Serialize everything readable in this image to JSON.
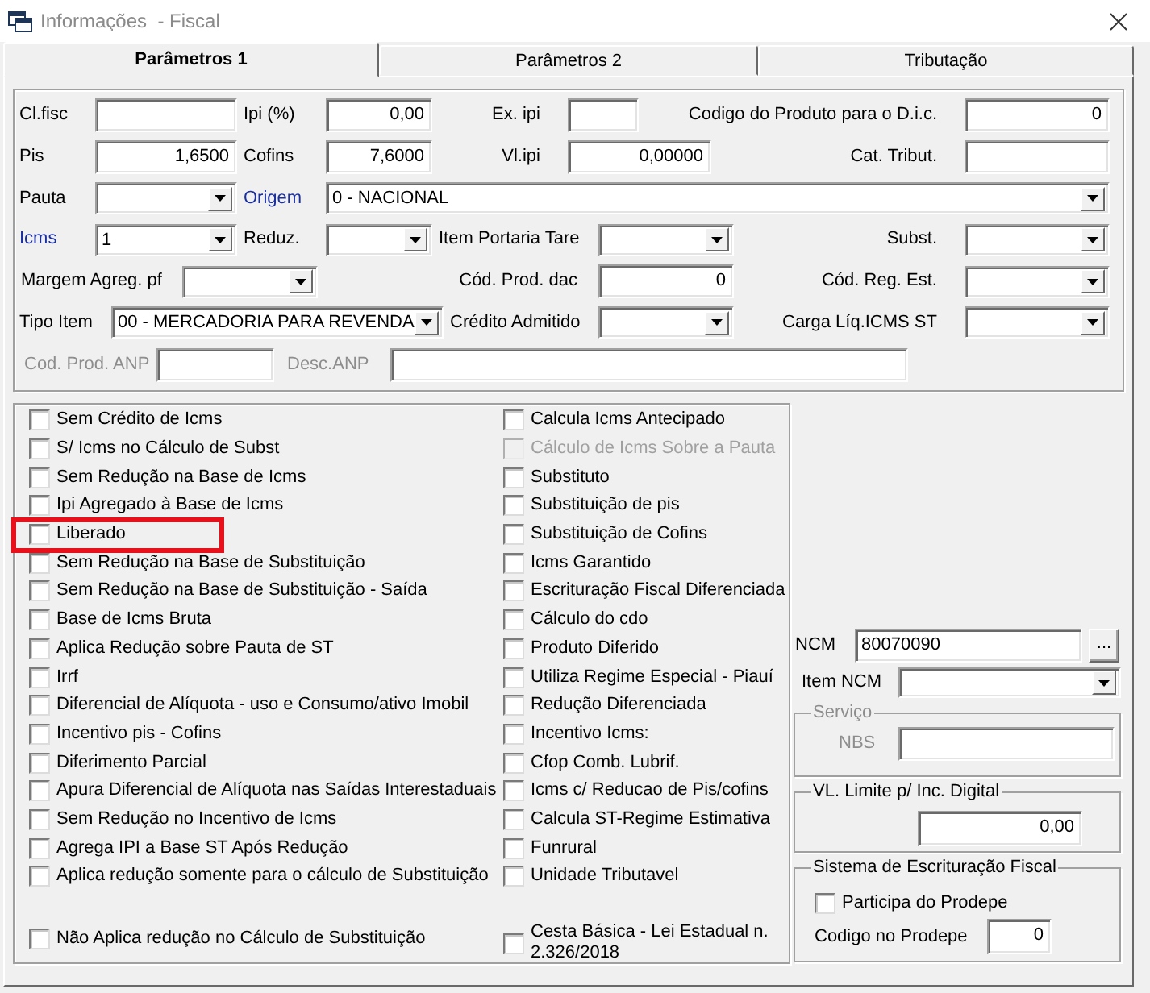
{
  "window": {
    "title": "Informações  - Fiscal"
  },
  "tabs": [
    {
      "label": "Parâmetros 1",
      "selected": true
    },
    {
      "label": "Parâmetros 2",
      "selected": false
    },
    {
      "label": "Tributação",
      "selected": false
    }
  ],
  "form_rows": [
    [
      {
        "label": "Cl.fisc",
        "kind": "text",
        "link": false,
        "disabled": false
      },
      {
        "label": "Ipi (%)",
        "kind": "number",
        "value": "0,00",
        "link": false,
        "disabled": false
      },
      {
        "label": "Ex. ipi",
        "kind": "text",
        "link": false,
        "disabled": false
      },
      {
        "label": "Codigo do Produto para o D.i.c.",
        "kind": "number",
        "value": "0",
        "link": false,
        "disabled": false
      }
    ],
    [
      {
        "label": "Pis",
        "kind": "number",
        "value": "1,6500",
        "link": false,
        "disabled": false
      },
      {
        "label": "Cofins",
        "kind": "number",
        "value": "7,6000",
        "link": false,
        "disabled": false
      },
      {
        "label": "Vl.ipi",
        "kind": "number",
        "value": "0,00000",
        "link": false,
        "disabled": false
      },
      {
        "label": "Cat. Tribut.",
        "kind": "text",
        "link": false,
        "disabled": false
      }
    ],
    [
      {
        "label": "Pauta",
        "kind": "combo",
        "link": false,
        "disabled": false
      },
      {
        "label": "Origem",
        "kind": "combo",
        "value": "0 - NACIONAL",
        "link": true,
        "disabled": false
      }
    ],
    [
      {
        "label": "Icms",
        "kind": "combo",
        "value": "1",
        "link": true,
        "disabled": false
      },
      {
        "label": "Reduz.",
        "kind": "combo",
        "link": false,
        "disabled": false
      },
      {
        "label": "Item Portaria Tare",
        "kind": "combo",
        "link": false,
        "disabled": false
      },
      {
        "label": "Subst.",
        "kind": "combo",
        "link": false,
        "disabled": false
      }
    ],
    [
      {
        "label": "Margem Agreg. pf",
        "kind": "combo",
        "link": false,
        "disabled": false
      },
      {
        "label": "Cód. Prod. dac",
        "kind": "number",
        "value": "0",
        "link": false,
        "disabled": false
      },
      {
        "label": "Cód. Reg. Est.",
        "kind": "combo",
        "link": false,
        "disabled": false
      }
    ],
    [
      {
        "label": "Tipo Item",
        "kind": "combo",
        "value": "00 - MERCADORIA PARA REVENDA",
        "link": false,
        "disabled": false
      },
      {
        "label": "Crédito Admitido",
        "kind": "combo",
        "link": false,
        "disabled": false
      },
      {
        "label": "Carga Líq.ICMS ST",
        "kind": "combo",
        "link": false,
        "disabled": false
      }
    ],
    [
      {
        "label": "Cod. Prod. ANP",
        "kind": "text",
        "link": false,
        "disabled": true
      },
      {
        "label": "Desc.ANP",
        "kind": "text",
        "link": false,
        "disabled": true
      }
    ]
  ],
  "options_column_1": [
    {
      "label": "Sem Crédito de Icms",
      "checked": false,
      "disabled": false,
      "highlighted": false
    },
    {
      "label": "S/ Icms no Cálculo de Subst",
      "checked": false,
      "disabled": false,
      "highlighted": false
    },
    {
      "label": "Sem Redução na Base de Icms",
      "checked": false,
      "disabled": false,
      "highlighted": false
    },
    {
      "label": "Ipi Agregado à Base de Icms",
      "checked": false,
      "disabled": false,
      "highlighted": false
    },
    {
      "label": "Liberado",
      "checked": false,
      "disabled": false,
      "highlighted": true
    },
    {
      "label": "Sem Redução na Base de Substituição",
      "checked": false,
      "disabled": false,
      "highlighted": false
    },
    {
      "label": "Sem Redução na Base de Substituição - Saída",
      "checked": false,
      "disabled": false,
      "highlighted": false
    },
    {
      "label": "Base de Icms Bruta",
      "checked": false,
      "disabled": false,
      "highlighted": false
    },
    {
      "label": "Aplica Redução sobre Pauta de ST",
      "checked": false,
      "disabled": false,
      "highlighted": false
    },
    {
      "label": "Irrf",
      "checked": false,
      "disabled": false,
      "highlighted": false
    },
    {
      "label": "Diferencial de Alíquota - uso e Consumo/ativo Imobil",
      "checked": false,
      "disabled": false,
      "highlighted": false
    },
    {
      "label": "Incentivo pis - Cofins",
      "checked": false,
      "disabled": false,
      "highlighted": false
    },
    {
      "label": "Diferimento Parcial",
      "checked": false,
      "disabled": false,
      "highlighted": false
    },
    {
      "label": "Apura Diferencial de Alíquota nas Saídas Interestaduais",
      "checked": false,
      "disabled": false,
      "highlighted": false
    },
    {
      "label": "Sem Redução no Incentivo de Icms",
      "checked": false,
      "disabled": false,
      "highlighted": false
    },
    {
      "label": "Agrega IPI a Base ST Após Redução",
      "checked": false,
      "disabled": false,
      "highlighted": false
    },
    {
      "label": "Aplica redução somente para o cálculo de Substituição",
      "checked": false,
      "disabled": false,
      "highlighted": false
    },
    {
      "label": "Não Aplica redução no Cálculo de Substituição",
      "checked": false,
      "disabled": false,
      "highlighted": false
    }
  ],
  "options_column_2": [
    {
      "label": "Calcula Icms Antecipado",
      "checked": false,
      "disabled": false,
      "highlighted": false
    },
    {
      "label": "Cálculo de Icms Sobre a Pauta",
      "checked": false,
      "disabled": true,
      "highlighted": false
    },
    {
      "label": "Substituto",
      "checked": false,
      "disabled": false,
      "highlighted": false
    },
    {
      "label": "Substituição de pis",
      "checked": false,
      "disabled": false,
      "highlighted": false
    },
    {
      "label": "Substituição de Cofins",
      "checked": false,
      "disabled": false,
      "highlighted": false
    },
    {
      "label": "Icms Garantido",
      "checked": false,
      "disabled": false,
      "highlighted": false
    },
    {
      "label": "Escrituração Fiscal Diferenciada",
      "checked": false,
      "disabled": false,
      "highlighted": false
    },
    {
      "label": "Cálculo do cdo",
      "checked": false,
      "disabled": false,
      "highlighted": false
    },
    {
      "label": "Produto Diferido",
      "checked": false,
      "disabled": false,
      "highlighted": false
    },
    {
      "label": "Utiliza Regime Especial - Piauí",
      "checked": false,
      "disabled": false,
      "highlighted": false
    },
    {
      "label": "Redução Diferenciada",
      "checked": false,
      "disabled": false,
      "highlighted": false
    },
    {
      "label": "Incentivo Icms:",
      "checked": false,
      "disabled": false,
      "highlighted": false
    },
    {
      "label": "Cfop Comb. Lubrif.",
      "checked": false,
      "disabled": false,
      "highlighted": false
    },
    {
      "label": "Icms c/ Reducao de Pis/cofins",
      "checked": false,
      "disabled": false,
      "highlighted": false
    },
    {
      "label": "Calcula ST-Regime Estimativa",
      "checked": false,
      "disabled": false,
      "highlighted": false
    },
    {
      "label": "Funrural",
      "checked": false,
      "disabled": false,
      "highlighted": false
    },
    {
      "label": "Unidade Tributavel",
      "checked": false,
      "disabled": false,
      "highlighted": false
    },
    {
      "label": "Cesta Básica - Lei Estadual n. 2.326/2018",
      "checked": false,
      "disabled": false,
      "highlighted": false
    }
  ],
  "ncm": {
    "label": "NCM",
    "value": "80070090",
    "button_label": "..."
  },
  "item_ncm": {
    "label": "Item NCM"
  },
  "service_group": {
    "title": "Serviço",
    "disabled": true,
    "nbs_label": "NBS"
  },
  "limit_group": {
    "title": "VL. Limite p/ Inc. Digital",
    "value": "0,00"
  },
  "sef_group": {
    "title": "Sistema de Escrituração  Fiscal",
    "checkbox": {
      "label": "Participa do Prodepe",
      "checked": false
    },
    "code_label": "Codigo no Prodepe",
    "code_value": "0"
  }
}
